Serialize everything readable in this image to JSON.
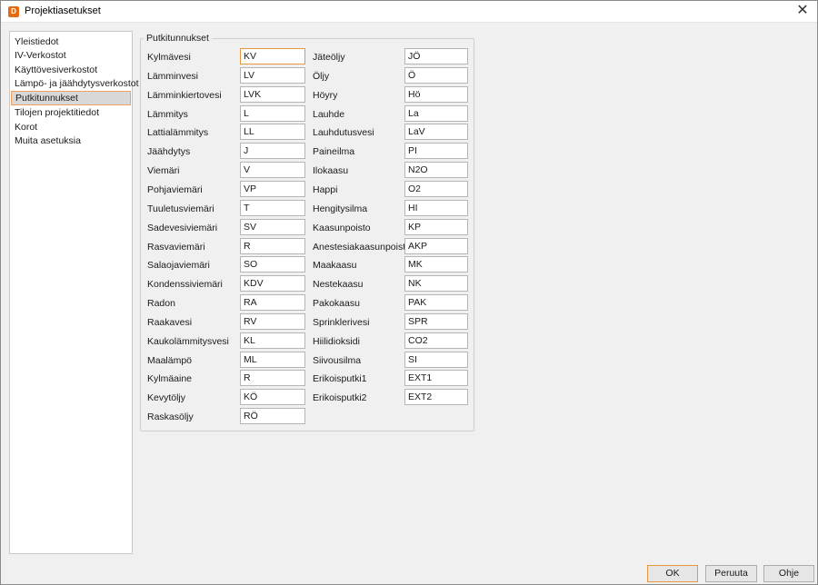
{
  "window": {
    "title": "Projektiasetukset",
    "icon_letter": "D",
    "close_glyph": "✕"
  },
  "sidebar": {
    "items": [
      {
        "label": "Yleistiedot",
        "selected": false
      },
      {
        "label": "IV-Verkostot",
        "selected": false
      },
      {
        "label": "Käyttövesiverkostot",
        "selected": false
      },
      {
        "label": "Lämpö- ja jäähdytysverkostot",
        "selected": false
      },
      {
        "label": "Putkitunnukset",
        "selected": true
      },
      {
        "label": "Tilojen projektitiedot",
        "selected": false
      },
      {
        "label": "Korot",
        "selected": false
      },
      {
        "label": "Muita asetuksia",
        "selected": false
      }
    ]
  },
  "group": {
    "title": "Putkitunnukset",
    "left": [
      {
        "label": "Kylmävesi",
        "value": "KV"
      },
      {
        "label": "Lämminvesi",
        "value": "LV"
      },
      {
        "label": "Lämminkiertovesi",
        "value": "LVK"
      },
      {
        "label": "Lämmitys",
        "value": "L"
      },
      {
        "label": "Lattialämmitys",
        "value": "LL"
      },
      {
        "label": "Jäähdytys",
        "value": "J"
      },
      {
        "label": "Viemäri",
        "value": "V"
      },
      {
        "label": "Pohjaviemäri",
        "value": "VP"
      },
      {
        "label": "Tuuletusviemäri",
        "value": "T"
      },
      {
        "label": "Sadevesiviemäri",
        "value": "SV"
      },
      {
        "label": "Rasvaviemäri",
        "value": "R"
      },
      {
        "label": "Salaojaviemäri",
        "value": "SO"
      },
      {
        "label": "Kondenssiviemäri",
        "value": "KDV"
      },
      {
        "label": "Radon",
        "value": "RA"
      },
      {
        "label": "Raakavesi",
        "value": "RV"
      },
      {
        "label": "Kaukolämmitysvesi",
        "value": "KL"
      },
      {
        "label": "Maalämpö",
        "value": "ML"
      },
      {
        "label": "Kylmäaine",
        "value": "R"
      },
      {
        "label": "Kevytöljy",
        "value": "KÖ"
      },
      {
        "label": "Raskasöljy",
        "value": "RÖ"
      }
    ],
    "right": [
      {
        "label": "Jäteöljy",
        "value": "JÖ"
      },
      {
        "label": "Öljy",
        "value": "Ö"
      },
      {
        "label": "Höyry",
        "value": "Hö"
      },
      {
        "label": "Lauhde",
        "value": "La"
      },
      {
        "label": "Lauhdutusvesi",
        "value": "LaV"
      },
      {
        "label": "Paineilma",
        "value": "PI"
      },
      {
        "label": "Ilokaasu",
        "value": "N2O"
      },
      {
        "label": "Happi",
        "value": "O2"
      },
      {
        "label": "Hengitysilma",
        "value": "HI"
      },
      {
        "label": "Kaasunpoisto",
        "value": "KP"
      },
      {
        "label": "Anestesiakaasunpoisto",
        "value": "AKP"
      },
      {
        "label": "Maakaasu",
        "value": "MK"
      },
      {
        "label": "Nestekaasu",
        "value": "NK"
      },
      {
        "label": "Pakokaasu",
        "value": "PAK"
      },
      {
        "label": "Sprinklerivesi",
        "value": "SPR"
      },
      {
        "label": "Hiilidioksidi",
        "value": "CO2"
      },
      {
        "label": "Siivousilma",
        "value": "SI"
      },
      {
        "label": "Erikoisputki1",
        "value": "EXT1"
      },
      {
        "label": "Erikoisputki2",
        "value": "EXT2"
      }
    ]
  },
  "buttons": {
    "ok": "OK",
    "cancel": "Peruuta",
    "help": "Ohje"
  },
  "colors": {
    "accent": "#e8963f",
    "app_icon": "#e66a12",
    "selection_bg": "#d8d8d8"
  }
}
